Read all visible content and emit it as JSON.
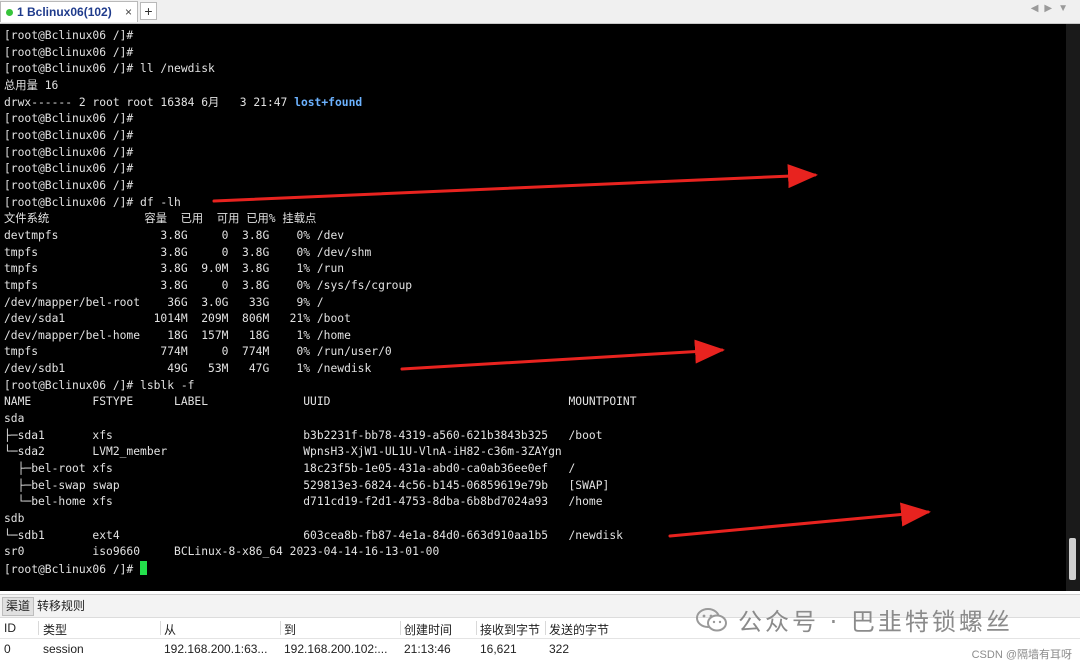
{
  "tab": {
    "title": "1 Bclinux06(102)",
    "close": "×",
    "new_tab": "+"
  },
  "terminal_lines": [
    [
      {
        "t": "[root@Bclinux06 /]#"
      }
    ],
    [
      {
        "t": "[root@Bclinux06 /]#"
      }
    ],
    [
      {
        "t": "[root@Bclinux06 /]# ll /newdisk"
      }
    ],
    [
      {
        "t": "总用量 16"
      }
    ],
    [
      {
        "t": "drwx------ 2 root root 16384 6月   3 21:47 "
      },
      {
        "t": "lost+found",
        "c": "dir"
      }
    ],
    [
      {
        "t": "[root@Bclinux06 /]#"
      }
    ],
    [
      {
        "t": "[root@Bclinux06 /]#"
      }
    ],
    [
      {
        "t": "[root@Bclinux06 /]#"
      }
    ],
    [
      {
        "t": "[root@Bclinux06 /]#"
      }
    ],
    [
      {
        "t": "[root@Bclinux06 /]#"
      }
    ],
    [
      {
        "t": "[root@Bclinux06 /]# df -lh"
      }
    ],
    [
      {
        "t": "文件系统              容量  已用  可用 已用% 挂载点"
      }
    ],
    [
      {
        "t": "devtmpfs               3.8G     0  3.8G    0% /dev"
      }
    ],
    [
      {
        "t": "tmpfs                  3.8G     0  3.8G    0% /dev/shm"
      }
    ],
    [
      {
        "t": "tmpfs                  3.8G  9.0M  3.8G    1% /run"
      }
    ],
    [
      {
        "t": "tmpfs                  3.8G     0  3.8G    0% /sys/fs/cgroup"
      }
    ],
    [
      {
        "t": "/dev/mapper/bel-root    36G  3.0G   33G    9% /"
      }
    ],
    [
      {
        "t": "/dev/sda1             1014M  209M  806M   21% /boot"
      }
    ],
    [
      {
        "t": "/dev/mapper/bel-home    18G  157M   18G    1% /home"
      }
    ],
    [
      {
        "t": "tmpfs                  774M     0  774M    0% /run/user/0"
      }
    ],
    [
      {
        "t": "/dev/sdb1               49G   53M   47G    1% /newdisk"
      }
    ],
    [
      {
        "t": "[root@Bclinux06 /]# lsblk -f"
      }
    ],
    [
      {
        "t": "NAME         FSTYPE      LABEL              UUID                                   MOUNTPOINT"
      }
    ],
    [
      {
        "t": "sda"
      }
    ],
    [
      {
        "t": "├─sda1       xfs                            b3b2231f-bb78-4319-a560-621b3843b325   /boot"
      }
    ],
    [
      {
        "t": "└─sda2       LVM2_member                    WpnsH3-XjW1-UL1U-VlnA-iH82-c36m-3ZAYgn"
      }
    ],
    [
      {
        "t": "  ├─bel-root xfs                            18c23f5b-1e05-431a-abd0-ca0ab36ee0ef   /"
      }
    ],
    [
      {
        "t": "  ├─bel-swap swap                           529813e3-6824-4c56-b145-06859619e79b   [SWAP]"
      }
    ],
    [
      {
        "t": "  └─bel-home xfs                            d711cd19-f2d1-4753-8dba-6b8bd7024a93   /home"
      }
    ],
    [
      {
        "t": "sdb"
      }
    ],
    [
      {
        "t": "└─sdb1       ext4                           603cea8b-fb87-4e1a-84d0-663d910aa1b5   /newdisk"
      }
    ],
    [
      {
        "t": "sr0          iso9660     BCLinux-8-x86_64 2023-04-14-16-13-01-00"
      }
    ],
    [
      {
        "t": "[root@Bclinux06 /]# "
      },
      {
        "cursor": true
      }
    ]
  ],
  "panel": {
    "tabs": [
      "渠道",
      "转移规则"
    ],
    "columns": [
      "ID",
      "类型",
      "从",
      "到",
      "创建时间",
      "接收到字节",
      "发送的字节"
    ],
    "rows": [
      [
        "0",
        "session",
        "192.168.200.1:63...",
        "192.168.200.102:...",
        "21:13:46",
        "16,621",
        "322"
      ]
    ]
  },
  "watermark": {
    "text": "公众号 · 巴韭特锁螺丝"
  },
  "footer_credit": "CSDN @隔墙有耳呀",
  "colors": {
    "terminal_bg": "#000000",
    "terminal_fg": "#e2e2e2",
    "directory": "#6cb2ff",
    "cursor": "#23e04b",
    "arrow": "#e8231f"
  }
}
